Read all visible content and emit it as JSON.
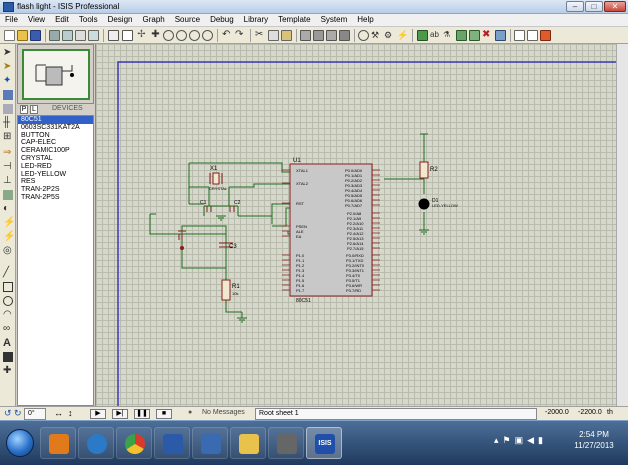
{
  "window": {
    "title": "flash light - ISIS Professional"
  },
  "menu": [
    "File",
    "View",
    "Edit",
    "Tools",
    "Design",
    "Graph",
    "Source",
    "Debug",
    "Library",
    "Template",
    "System",
    "Help"
  ],
  "devices": {
    "tab_p": "P",
    "tab_l": "L",
    "title": "DEVICES",
    "items": [
      "80C51",
      "0603SC331KAT2A",
      "BUTTON",
      "CAP-ELEC",
      "CERAMIC100P",
      "CRYSTAL",
      "LED-RED",
      "LED-YELLOW",
      "RES",
      "TRAN-2P2S",
      "TRAN-2P5S"
    ],
    "selected_index": 0
  },
  "schematic": {
    "u1_ref": "U1",
    "u1_name": "80C51",
    "x1_ref": "X1",
    "x1_val": "CRYSTAL",
    "c1_ref": "C1",
    "c2_ref": "C2",
    "c3_ref": "C3",
    "r1_ref": "R1",
    "r1_val": "10k",
    "r2_ref": "R2",
    "d1_ref": "D1",
    "d1_val": "LED-YELLOW",
    "pin_xtal1": "XTAL1",
    "pin_xtal2": "XTAL2",
    "pin_rst": "RST",
    "pin_psen": "PSEN",
    "pin_ale": "ALE",
    "pin_ea": "EA",
    "p1_pins": [
      "P1.0",
      "P1.1",
      "P1.2",
      "P1.3",
      "P1.4",
      "P1.5",
      "P1.6",
      "P1.7"
    ],
    "p0_pins": [
      "P0.0/AD0",
      "P0.1/AD1",
      "P0.2/AD2",
      "P0.3/AD3",
      "P0.4/AD4",
      "P0.5/AD5",
      "P0.6/AD6",
      "P0.7/AD7"
    ],
    "p2_pins": [
      "P2.0/A8",
      "P2.1/A9",
      "P2.2/A10",
      "P2.3/A11",
      "P2.4/A12",
      "P2.5/A13",
      "P2.6/A14",
      "P2.7/A15"
    ],
    "p3_pins": [
      "P3.0/RXD",
      "P3.1/TXD",
      "P3.2/INT0",
      "P3.3/INT1",
      "P3.4/T0",
      "P3.5/T1",
      "P3.6/WR",
      "P3.7/RD"
    ]
  },
  "status": {
    "rotation": "0°",
    "messages": "No Messages",
    "sheet": "Root sheet 1",
    "coord_x": "-2000.0",
    "coord_y": "-2200.0",
    "unit": "th"
  },
  "taskbar": {
    "time": "2:54 PM",
    "date": "11/27/2013",
    "isis_label": "ISIS"
  },
  "colors": {
    "sheet_border": "#3a3ab8",
    "wire": "#1f6e1f",
    "component": "#8a1c1c",
    "chip_fill": "#c8c8c8",
    "led": "#000000"
  }
}
